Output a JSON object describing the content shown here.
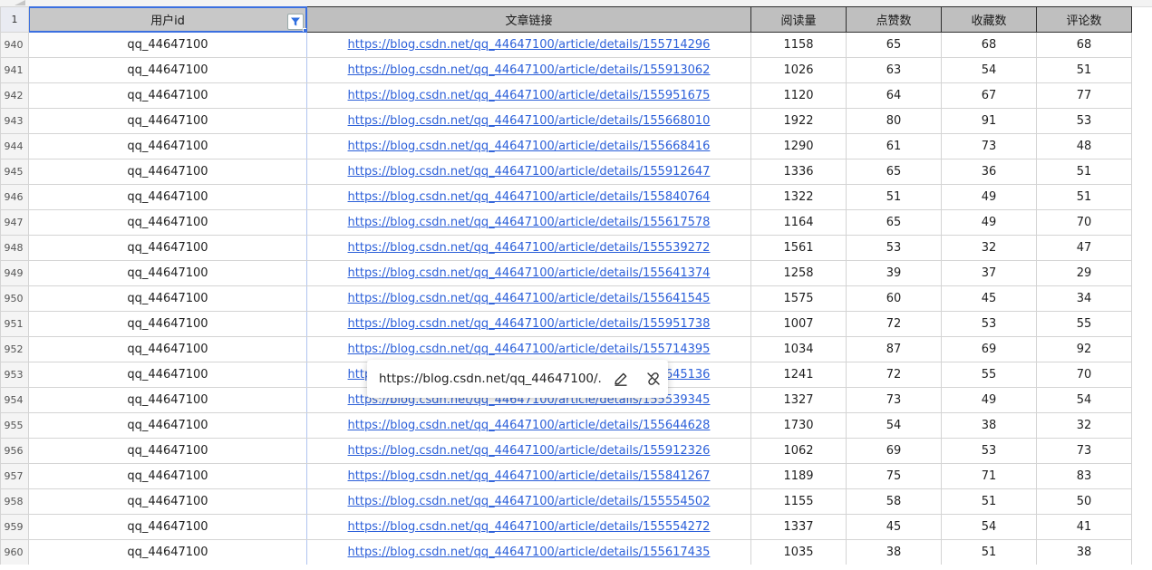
{
  "header": {
    "row_label": "1",
    "columns": [
      "用户id",
      "文章链接",
      "阅读量",
      "点赞数",
      "收藏数",
      "评论数"
    ]
  },
  "rows": [
    {
      "num": "940",
      "user": "qq_44647100",
      "link": "https://blog.csdn.net/qq_44647100/article/details/155714296",
      "reads": "1158",
      "likes": "65",
      "favs": "68",
      "comments": "68"
    },
    {
      "num": "941",
      "user": "qq_44647100",
      "link": "https://blog.csdn.net/qq_44647100/article/details/155913062",
      "reads": "1026",
      "likes": "63",
      "favs": "54",
      "comments": "51"
    },
    {
      "num": "942",
      "user": "qq_44647100",
      "link": "https://blog.csdn.net/qq_44647100/article/details/155951675",
      "reads": "1120",
      "likes": "64",
      "favs": "67",
      "comments": "77"
    },
    {
      "num": "943",
      "user": "qq_44647100",
      "link": "https://blog.csdn.net/qq_44647100/article/details/155668010",
      "reads": "1922",
      "likes": "80",
      "favs": "91",
      "comments": "53"
    },
    {
      "num": "944",
      "user": "qq_44647100",
      "link": "https://blog.csdn.net/qq_44647100/article/details/155668416",
      "reads": "1290",
      "likes": "61",
      "favs": "73",
      "comments": "48"
    },
    {
      "num": "945",
      "user": "qq_44647100",
      "link": "https://blog.csdn.net/qq_44647100/article/details/155912647",
      "reads": "1336",
      "likes": "65",
      "favs": "36",
      "comments": "51"
    },
    {
      "num": "946",
      "user": "qq_44647100",
      "link": "https://blog.csdn.net/qq_44647100/article/details/155840764",
      "reads": "1322",
      "likes": "51",
      "favs": "49",
      "comments": "51"
    },
    {
      "num": "947",
      "user": "qq_44647100",
      "link": "https://blog.csdn.net/qq_44647100/article/details/155617578",
      "reads": "1164",
      "likes": "65",
      "favs": "49",
      "comments": "70"
    },
    {
      "num": "948",
      "user": "qq_44647100",
      "link": "https://blog.csdn.net/qq_44647100/article/details/155539272",
      "reads": "1561",
      "likes": "53",
      "favs": "32",
      "comments": "47"
    },
    {
      "num": "949",
      "user": "qq_44647100",
      "link": "https://blog.csdn.net/qq_44647100/article/details/155641374",
      "reads": "1258",
      "likes": "39",
      "favs": "37",
      "comments": "29"
    },
    {
      "num": "950",
      "user": "qq_44647100",
      "link": "https://blog.csdn.net/qq_44647100/article/details/155641545",
      "reads": "1575",
      "likes": "60",
      "favs": "45",
      "comments": "34"
    },
    {
      "num": "951",
      "user": "qq_44647100",
      "link": "https://blog.csdn.net/qq_44647100/article/details/155951738",
      "reads": "1007",
      "likes": "72",
      "favs": "53",
      "comments": "55"
    },
    {
      "num": "952",
      "user": "qq_44647100",
      "link": "https://blog.csdn.net/qq_44647100/article/details/155714395",
      "reads": "1034",
      "likes": "87",
      "favs": "69",
      "comments": "92"
    },
    {
      "num": "953",
      "user": "qq_44647100",
      "link": "https://blog.csdn.net/qq_44647100/article/details/155645136",
      "reads": "1241",
      "likes": "72",
      "favs": "55",
      "comments": "70"
    },
    {
      "num": "954",
      "user": "qq_44647100",
      "link": "https://blog.csdn.net/qq_44647100/article/details/155539345",
      "reads": "1327",
      "likes": "73",
      "favs": "49",
      "comments": "54"
    },
    {
      "num": "955",
      "user": "qq_44647100",
      "link": "https://blog.csdn.net/qq_44647100/article/details/155644628",
      "reads": "1730",
      "likes": "54",
      "favs": "38",
      "comments": "32"
    },
    {
      "num": "956",
      "user": "qq_44647100",
      "link": "https://blog.csdn.net/qq_44647100/article/details/155912326",
      "reads": "1062",
      "likes": "69",
      "favs": "53",
      "comments": "73"
    },
    {
      "num": "957",
      "user": "qq_44647100",
      "link": "https://blog.csdn.net/qq_44647100/article/details/155841267",
      "reads": "1189",
      "likes": "75",
      "favs": "71",
      "comments": "83"
    },
    {
      "num": "958",
      "user": "qq_44647100",
      "link": "https://blog.csdn.net/qq_44647100/article/details/155554502",
      "reads": "1155",
      "likes": "58",
      "favs": "51",
      "comments": "50"
    },
    {
      "num": "959",
      "user": "qq_44647100",
      "link": "https://blog.csdn.net/qq_44647100/article/details/155554272",
      "reads": "1337",
      "likes": "45",
      "favs": "54",
      "comments": "41"
    },
    {
      "num": "960",
      "user": "qq_44647100",
      "link": "https://blog.csdn.net/qq_44647100/article/details/155617435",
      "reads": "1035",
      "likes": "38",
      "favs": "51",
      "comments": "38"
    }
  ],
  "popup": {
    "url_text": "https://blog.csdn.net/qq_44647100/..."
  },
  "colors": {
    "link": "#2b5fd9",
    "header_bg": "#bfbfbf",
    "selection": "#3a6fe0",
    "filter_icon": "#2f6fe0"
  },
  "icons": {
    "filter": "filter-icon",
    "edit": "edit-pencil-icon",
    "unlink": "unlink-icon"
  }
}
